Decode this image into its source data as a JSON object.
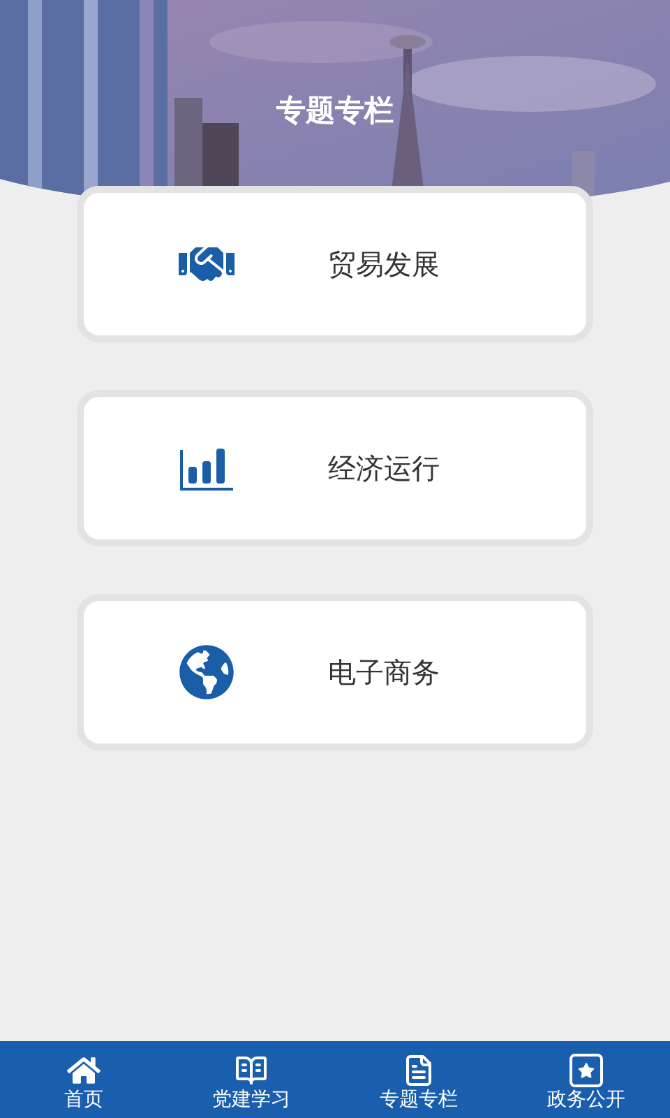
{
  "header": {
    "title": "专题专栏"
  },
  "cards": [
    {
      "kind": "trade",
      "label": "贸易发展"
    },
    {
      "kind": "economy",
      "label": "经济运行"
    },
    {
      "kind": "ecommerce",
      "label": "电子商务"
    }
  ],
  "tab_bar": [
    {
      "kind": "home",
      "label": "首页"
    },
    {
      "kind": "party",
      "label": "党建学习"
    },
    {
      "kind": "topics",
      "label": "专题专栏"
    },
    {
      "kind": "gov",
      "label": "政务公开"
    }
  ]
}
